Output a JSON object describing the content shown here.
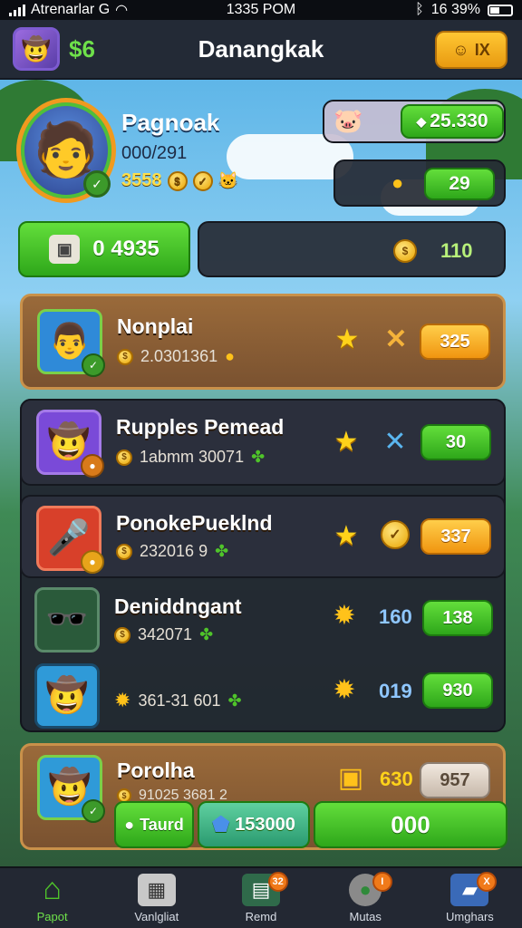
{
  "status_bar": {
    "carrier": "Atrenarlar G",
    "time": "1335 POM",
    "battery": "16 39%"
  },
  "header": {
    "coins": "$6",
    "title": "Danangkak",
    "action_label": "IX"
  },
  "profile": {
    "name": "Pagnoak",
    "id": "000/291",
    "level": "3558",
    "gem_balance": "25.330",
    "energy": "29",
    "chest_value": "0 4935",
    "gold_balance": "110"
  },
  "players": [
    {
      "name": "Nonplai",
      "score": "2.0301361",
      "value": "325",
      "style": "gold",
      "pill": "orange",
      "avatar": "👨",
      "avatar_bg": "#2f8ad8"
    },
    {
      "name": "Rupples Pemead",
      "score": "1abmm 30071",
      "value": "30",
      "style": "dark",
      "pill": "green",
      "avatar": "🤠",
      "avatar_bg": "#7a4ad8"
    },
    {
      "name": "PonokePueklnd",
      "score": "232016 9",
      "value": "337",
      "style": "dark",
      "pill": "orange",
      "avatar": "🎤",
      "avatar_bg": "#d8402a"
    },
    {
      "name": "Deniddngant",
      "score": "342071",
      "rank": "160",
      "value": "138",
      "style": "dark",
      "pill": "green",
      "avatar": "🕶️",
      "avatar_bg": "#2a5a3a"
    },
    {
      "name": "",
      "score": "361-31 601",
      "rank": "019",
      "value": "930",
      "style": "dark",
      "pill": "green",
      "avatar": "🤠",
      "avatar_bg": "#2f9ad8"
    },
    {
      "name": "Porolha",
      "score": "91025 3681 2",
      "rank": "630",
      "value": "957",
      "style": "gold",
      "pill": "grey",
      "avatar": "🤠",
      "avatar_bg": "#2f9ad8"
    }
  ],
  "action_bar": {
    "left_label": "Taurd",
    "middle_value": "153000",
    "right_value": "000"
  },
  "nav": {
    "items": [
      {
        "label": "Papot",
        "icon": "home-icon",
        "badge": ""
      },
      {
        "label": "Vanlgliat",
        "icon": "grid-icon",
        "badge": ""
      },
      {
        "label": "Remd",
        "icon": "book-icon",
        "badge": "32"
      },
      {
        "label": "Mutas",
        "icon": "globe-icon",
        "badge": "I"
      },
      {
        "label": "Umghars",
        "icon": "cards-icon",
        "badge": "X"
      }
    ]
  },
  "colors": {
    "accent_green": "#4fc42a",
    "accent_orange": "#f0a01a",
    "panel_dark": "#262a34",
    "gold_row": "#8a5e36"
  }
}
